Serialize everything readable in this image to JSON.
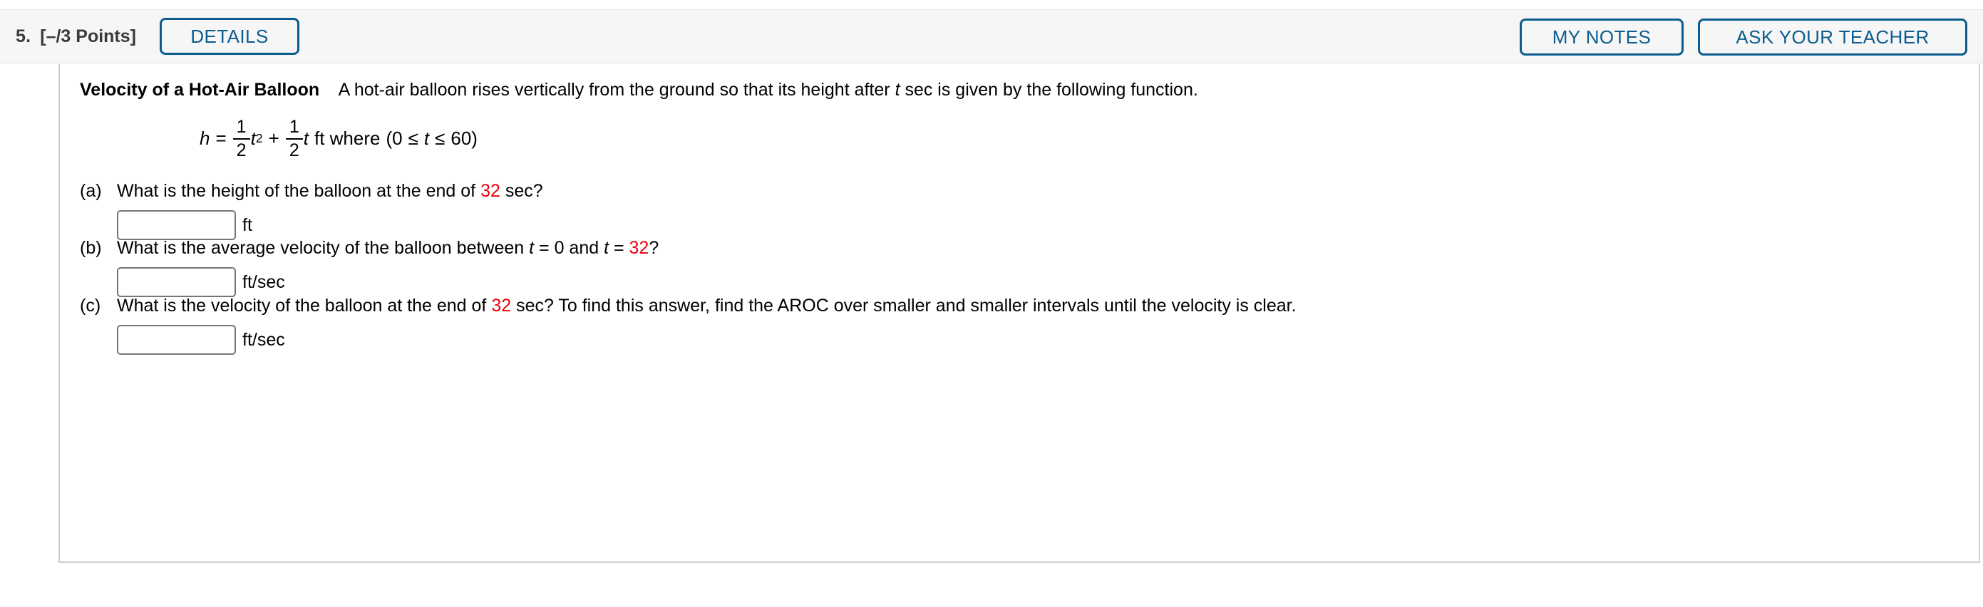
{
  "header": {
    "question_number": "5.",
    "points": "[–/3 Points]",
    "details_label": "DETAILS",
    "my_notes_label": "MY NOTES",
    "ask_your_teacher_label": "ASK YOUR TEACHER",
    "accent_color": "#0b5c8f",
    "background_color": "#f6f6f6"
  },
  "problem": {
    "title": "Velocity of a Hot-Air Balloon",
    "description": "A hot-air balloon rises vertically from the ground so that its height after t sec is given by the following function.",
    "formula": {
      "lhs": "h",
      "equals": "=",
      "term1_num": "1",
      "term1_den": "2",
      "term1_var": "t",
      "term1_exp": "2",
      "plus": "+",
      "term2_num": "1",
      "term2_den": "2",
      "term2_var": "t",
      "units": "ft where",
      "domain_open": "(0",
      "domain_le1": "≤",
      "domain_var": "t",
      "domain_le2": "≤",
      "domain_max": "60)"
    },
    "highlight_color": "#e8000b",
    "parts": [
      {
        "label": "(a)",
        "question_pre": "What is the height of the balloon at the end of ",
        "question_value": "32",
        "question_post": " sec?",
        "answer_value": "",
        "answer_placeholder": "",
        "unit": "ft"
      },
      {
        "label": "(b)",
        "question_pre": "What is the average velocity of the balloon between t = 0 and t = ",
        "question_value": "32",
        "question_post": "?",
        "answer_value": "",
        "answer_placeholder": "",
        "unit": "ft/sec"
      },
      {
        "label": "(c)",
        "question_pre": "What is the velocity of the balloon at the end of ",
        "question_value": "32",
        "question_post": " sec? To find this answer, find the AROC over smaller and smaller intervals until the velocity is clear.",
        "answer_value": "",
        "answer_placeholder": "",
        "unit": "ft/sec"
      }
    ]
  }
}
